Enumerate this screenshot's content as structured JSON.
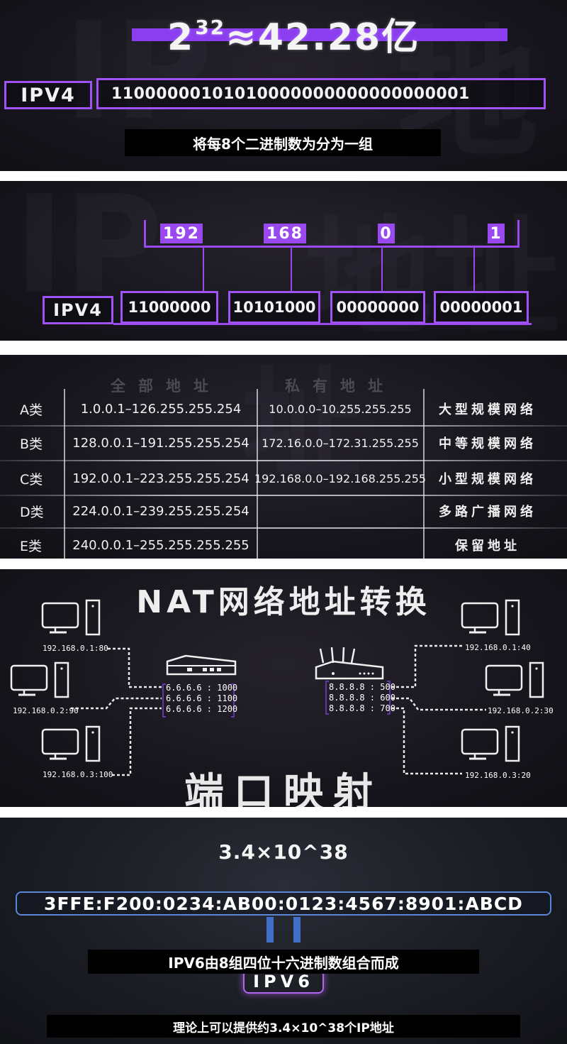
{
  "panel1": {
    "formula_base": "2",
    "formula_exp": "32",
    "formula_rest": "≈42.28亿",
    "ipv4_label": "IPV4",
    "binary": "11000000101010000000000000000001",
    "subtitle": "将每8个二进制数为分为一组"
  },
  "panel2": {
    "decimals": [
      "192",
      "168",
      "0",
      "1"
    ],
    "ipv4_label": "IPV4",
    "binary_groups": [
      "11000000",
      "10101000",
      "00000000",
      "00000001"
    ]
  },
  "panel3": {
    "header_all": "全部地址",
    "header_private": "私有地址",
    "rows": [
      {
        "cls": "A类",
        "all": "1.0.0.1–126.255.255.254",
        "private": "10.0.0.0–10.255.255.255",
        "type": "大型规模网络"
      },
      {
        "cls": "B类",
        "all": "128.0.0.1–191.255.255.254",
        "private": "172.16.0.0–172.31.255.255",
        "type": "中等规模网络"
      },
      {
        "cls": "C类",
        "all": "192.0.0.1–223.255.255.254",
        "private": "192.168.0.0–192.168.255.255",
        "type": "小型规模网络"
      },
      {
        "cls": "D类",
        "all": "224.0.0.1–239.255.255.254",
        "private": "",
        "type": "多路广播网络"
      },
      {
        "cls": "E类",
        "all": "240.0.0.1–255.255.255.255",
        "private": "",
        "type": "保留地址"
      }
    ]
  },
  "panel4": {
    "title": "NAT网络地址转换",
    "subtitle": "端口映射",
    "left_pcs": [
      "192.168.0.1:80",
      "192.168.0.2:90",
      "192.168.0.3:100"
    ],
    "right_pcs": [
      "192.168.0.1:40",
      "192.168.0.2:30",
      "192.168.0.3:20"
    ],
    "left_ports": "6.6.6.6 : 1000\n6.6.6.6 : 1100\n6.6.6.6 : 1200",
    "right_ports": "8.8.8.8 : 500\n8.8.8.8 : 600\n8.8.8.8 : 700"
  },
  "panel5": {
    "big_number": "3.4×10^38",
    "address": "3FFE:F200:0234:AB00:0123:4567:8901:ABCD",
    "ipv6_label": "IPV6",
    "subtitle1": "IPV6由8组四位十六进制数组合而成",
    "subtitle2": "理论上可以提供约3.4×10^38个IP地址"
  },
  "colors": {
    "accent_purple": "#9a48f0",
    "accent_blue": "#5a86d8",
    "background_dark": "#18161d"
  }
}
